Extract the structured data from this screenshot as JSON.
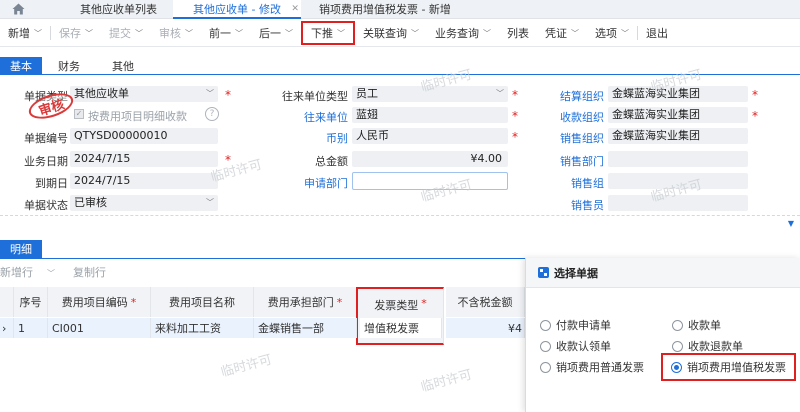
{
  "tabs": [
    {
      "label": "其他应收单列表",
      "active": false
    },
    {
      "label": "其他应收单 - 修改",
      "active": true
    },
    {
      "label": "销项费用增值税发票 - 新增",
      "active": false
    }
  ],
  "toolbar": [
    {
      "label": "新增",
      "dropdown": true,
      "disabled": false
    },
    {
      "label": "保存",
      "dropdown": true,
      "disabled": true
    },
    {
      "label": "提交",
      "dropdown": true,
      "disabled": true
    },
    {
      "label": "审核",
      "dropdown": true,
      "disabled": true
    },
    {
      "label": "前一",
      "dropdown": true,
      "disabled": false
    },
    {
      "label": "后一",
      "dropdown": true,
      "disabled": false
    },
    {
      "label": "下推",
      "dropdown": true,
      "disabled": false,
      "highlighted": true
    },
    {
      "label": "关联查询",
      "dropdown": true,
      "disabled": false
    },
    {
      "label": "业务查询",
      "dropdown": true,
      "disabled": false
    },
    {
      "label": "列表",
      "dropdown": false,
      "disabled": false
    },
    {
      "label": "凭证",
      "dropdown": true,
      "disabled": false
    },
    {
      "label": "选项",
      "dropdown": true,
      "disabled": false
    },
    {
      "label": "退出",
      "dropdown": false,
      "disabled": false
    }
  ],
  "form_tabs": [
    "基本",
    "财务",
    "其他"
  ],
  "stamp_text": "审核",
  "form": {
    "bill_type_label": "单据类型",
    "bill_type": "其他应收单",
    "by_item_label": "按费用项目明细收款",
    "bill_no_label": "单据编号",
    "bill_no": "QTYSD00000010",
    "biz_date_label": "业务日期",
    "biz_date": "2024/7/15",
    "due_date_label": "到期日",
    "due_date": "2024/7/15",
    "status_label": "单据状态",
    "status": "已审核",
    "partner_type_label": "往来单位类型",
    "partner_type": "员工",
    "partner_label": "往来单位",
    "partner": "蓝翅",
    "currency_label": "币别",
    "currency": "人民币",
    "total_label": "总金额",
    "total": "¥4.00",
    "apply_dept_label": "申请部门",
    "apply_dept": "",
    "settle_org_label": "结算组织",
    "settle_org": "金蝶蓝海实业集团",
    "recv_org_label": "收款组织",
    "recv_org": "金蝶蓝海实业集团",
    "sales_org_label": "销售组织",
    "sales_org": "金蝶蓝海实业集团",
    "sales_dept_label": "销售部门",
    "sales_dept": "",
    "sales_group_label": "销售组",
    "sales_group": "",
    "salesman_label": "销售员",
    "salesman": ""
  },
  "detail": {
    "tab": "明细",
    "add_row": "新增行",
    "copy_row": "复制行",
    "columns": [
      "序号",
      "费用项目编码",
      "费用项目名称",
      "费用承担部门",
      "发票类型",
      "不含税金额"
    ],
    "rows": [
      [
        "1",
        "CI001",
        "来料加工工资",
        "金蝶销售一部",
        "增值税发票",
        "¥4"
      ]
    ]
  },
  "popup": {
    "title": "选择单据",
    "options": [
      {
        "label": "付款申请单",
        "selected": false
      },
      {
        "label": "收款单",
        "selected": false
      },
      {
        "label": "收款认领单",
        "selected": false
      },
      {
        "label": "收款退款单",
        "selected": false
      },
      {
        "label": "销项费用普通发票",
        "selected": false
      },
      {
        "label": "销项费用增值税发票",
        "selected": true
      }
    ]
  },
  "watermark": "临时许可",
  "colors": {
    "accent": "#1e6fd9",
    "highlight": "#e02020",
    "stamp": "#d93a3a"
  }
}
